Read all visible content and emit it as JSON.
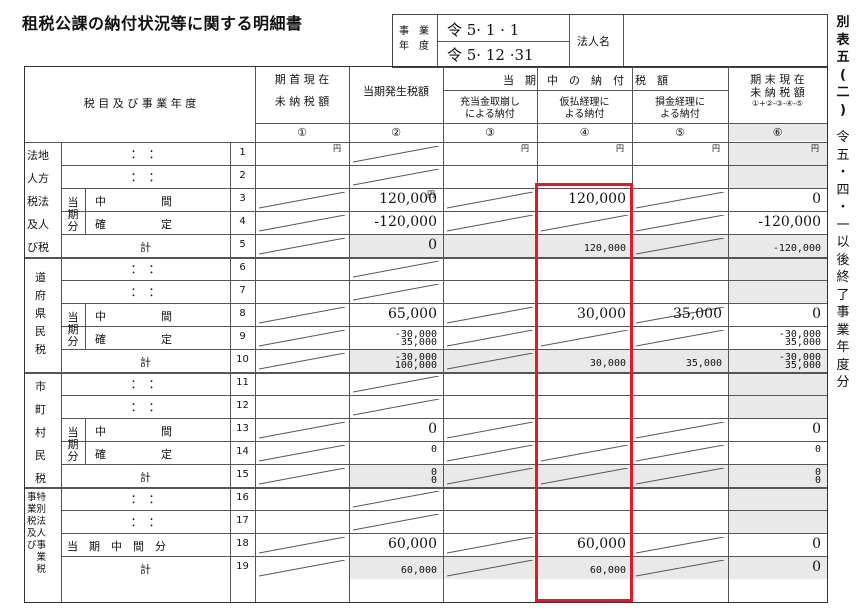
{
  "title": "租税公課の納付状況等に関する明細書",
  "header": {
    "jigyo_label_1": "事　業",
    "jigyo_label_2": "年　度",
    "date_from": "令 5· 1 · 1",
    "date_to": "令 5· 12 ·31",
    "corp_name_label": "法人名",
    "corp_name_value": ""
  },
  "sidebar": {
    "form_no": "別表五(二)",
    "version": "令五・四・一以後終了事業年度分"
  },
  "columns": {
    "item_label": "税 目 及 び 事 業 年 度",
    "c1": "期 首 現 在\n未 納 税 額",
    "c2": "当期発生税額",
    "group": "当　期　中　の　納　付　税　額",
    "c3": "充当金取崩し\nによる納付",
    "c4": "仮払経理に\nよる納付",
    "c5": "損金経理に\nよる納付",
    "c6": "期 末 現 在\n未 納 税 額",
    "c6_formula": "①+②-③-④-⑤",
    "n1": "①",
    "n2": "②",
    "n3": "③",
    "n4": "④",
    "n5": "⑤",
    "n6": "⑥"
  },
  "units": {
    "yen": "円"
  },
  "sections": {
    "hojin": [
      "法地",
      "人方",
      "税法",
      "及人",
      "び税"
    ],
    "fuken": [
      "道",
      "府",
      "県",
      "民",
      "税"
    ],
    "shicho": [
      "市",
      "町",
      "村",
      "民",
      "税"
    ],
    "tokubetsu": "事特\n業別\n税法\n及人\nび事\n　業\n　税",
    "toki_bun": "当\n期\n分",
    "chukan": "中　　　　　間",
    "kakutei": "確　　　　　定",
    "kei": "計",
    "toki_chukan_bun": "当　期　中　間　分",
    "dots": "：　：",
    "row_numbers": [
      "1",
      "2",
      "3",
      "4",
      "5",
      "6",
      "7",
      "8",
      "9",
      "10",
      "11",
      "12",
      "13",
      "14",
      "15",
      "16",
      "17",
      "18",
      "19"
    ]
  },
  "values": {
    "r3_c2": "120,000",
    "r3_c4": "120,000",
    "r3_c6": "0",
    "r4_c2": "-120,000",
    "r4_c6": "-120,000",
    "r5_c2": "0",
    "r5_c4": "120,000",
    "r5_c6": "-120,000",
    "r8_c2": "65,000",
    "r8_c4": "30,000",
    "r8_c5": "35,000",
    "r8_c6": "0",
    "r9_c2a": "-30,000",
    "r9_c2b": "35,000",
    "r9_c6a": "-30,000",
    "r9_c6b": "35,000",
    "r10_c2a": "-30,000",
    "r10_c2b": "100,000",
    "r10_c4": "30,000",
    "r10_c5": "35,000",
    "r10_c6a": "-30,000",
    "r10_c6b": "35,000",
    "r13_c2": "0",
    "r13_c6": "0",
    "r14_c2": "0",
    "r14_c6": "0",
    "r15_c2a": "0",
    "r15_c2b": "0",
    "r15_c6a": "0",
    "r15_c6b": "0",
    "r18_c2": "60,000",
    "r18_c4": "60,000",
    "r18_c6": "0",
    "r19_c2": "60,000",
    "r19_c4": "60,000",
    "r19_c6": "0"
  },
  "highlight_color": "#e01a2b"
}
